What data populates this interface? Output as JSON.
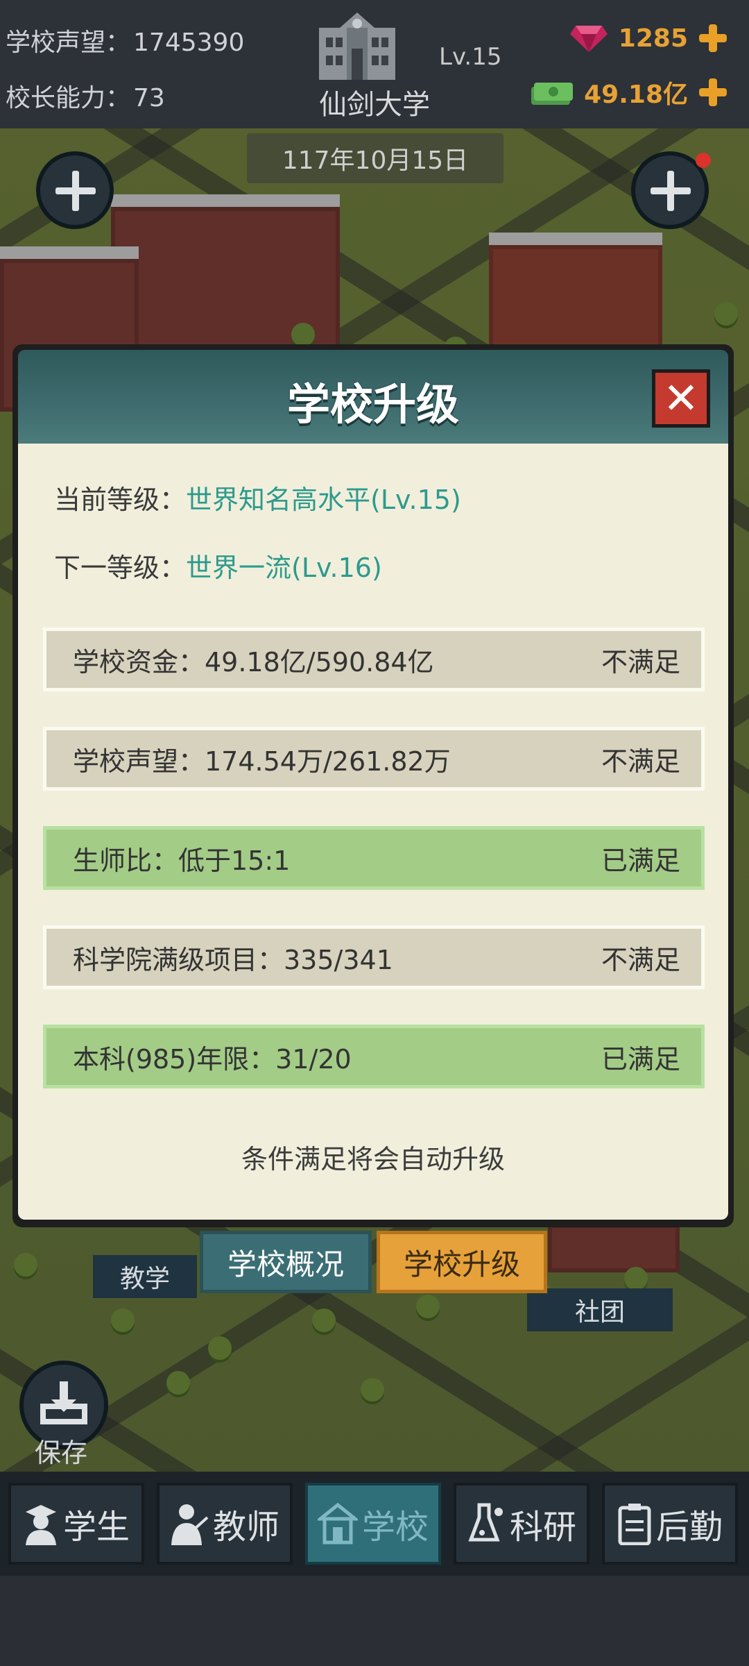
{
  "header": {
    "reputation_label": "学校声望：",
    "reputation_value": "1745390",
    "principal_label": "校长能力：",
    "principal_value": "73",
    "level": "Lv.15",
    "school_name": "仙剑大学",
    "gems": "1285",
    "money": "49.18亿",
    "date": "117年10月15日"
  },
  "modal": {
    "title": "学校升级",
    "current_label": "当前等级：",
    "current_value": "世界知名高水平(Lv.15)",
    "next_label": "下一等级：",
    "next_value": "世界一流(Lv.16)",
    "requirements": [
      {
        "text": "学校资金：49.18亿/590.84亿",
        "status": "不满足",
        "met": false
      },
      {
        "text": "学校声望：174.54万/261.82万",
        "status": "不满足",
        "met": false
      },
      {
        "text": "生师比：低于15:1",
        "status": "已满足",
        "met": true
      },
      {
        "text": "科学院满级项目：335/341",
        "status": "不满足",
        "met": false
      },
      {
        "text": "本科(985)年限：31/20",
        "status": "已满足",
        "met": true
      }
    ],
    "footer_note": "条件满足将会自动升级"
  },
  "tabs": {
    "overview": "学校概况",
    "upgrade": "学校升级"
  },
  "map_labels": {
    "teaching": "教学",
    "clubs": "社团"
  },
  "save_label": "保存",
  "bottom_nav": [
    {
      "label": "学生",
      "icon": "student-icon"
    },
    {
      "label": "教师",
      "icon": "teacher-icon"
    },
    {
      "label": "学校",
      "icon": "school-icon",
      "active": true
    },
    {
      "label": "科研",
      "icon": "flask-icon"
    },
    {
      "label": "后勤",
      "icon": "clipboard-icon"
    }
  ],
  "colors": {
    "accent_teal": "#2d9a8c",
    "met_green": "#a3cc87",
    "unmet_beige": "#d6d2bd",
    "currency_orange": "#e7a235",
    "close_red": "#c53a2e"
  }
}
